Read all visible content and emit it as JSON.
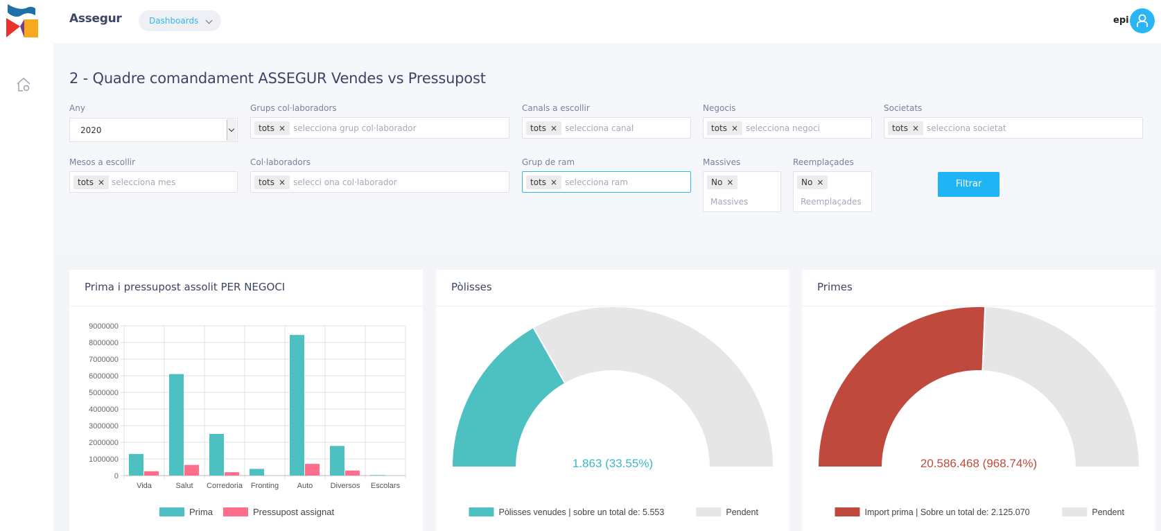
{
  "header": {
    "brand": "Assegur",
    "dashboards_label": "Dashboards",
    "user": "epi"
  },
  "page": {
    "title": "2 - Quadre comandament ASSEGUR Vendes vs Pressupost"
  },
  "filters": {
    "any": {
      "label": "Any",
      "value": "2020"
    },
    "grups": {
      "label": "Grups col·laboradors",
      "tag": "tots",
      "placeholder": "selecciona grup col·laborador"
    },
    "canals": {
      "label": "Canals a escollir",
      "tag": "tots",
      "placeholder": "selecciona canal"
    },
    "negocis": {
      "label": "Negocis",
      "tag": "tots",
      "placeholder": "selecciona negoci"
    },
    "societats": {
      "label": "Societats",
      "tag": "tots",
      "placeholder": "selecciona societat"
    },
    "mesos": {
      "label": "Mesos a escollir",
      "tag": "tots",
      "placeholder": "selecciona mes"
    },
    "collaboradors": {
      "label": "Col·laboradors",
      "tag": "tots",
      "placeholder": "selecci ona col·laborador"
    },
    "ram": {
      "label": "Grup de ram",
      "tag": "tots",
      "placeholder": "selecciona ram"
    },
    "massives": {
      "label": "Massives",
      "tag": "No",
      "placeholder": "Massives"
    },
    "reemplacades": {
      "label": "Reemplaçades",
      "tag": "No",
      "placeholder": "Reemplaçades"
    },
    "tag_remove": "×",
    "button": "Filtrar"
  },
  "colors": {
    "teal": "#4dc1c1",
    "pink": "#ff6d8d",
    "red": "#c0493d",
    "grey": "#e6e6e6",
    "accent": "#1fb5f5"
  },
  "cards": {
    "bar": {
      "title": "Prima i pressupost assolit PER NEGOCI"
    },
    "polisses": {
      "title": "Pòlisses"
    },
    "primes": {
      "title": "Primes"
    }
  },
  "chart_data": [
    {
      "type": "bar",
      "categories": [
        "Vida",
        "Salut",
        "Corredoria",
        "Fronting",
        "Auto",
        "Diversos",
        "Escolars"
      ],
      "series": [
        {
          "name": "Prima",
          "values": [
            1300000,
            6100000,
            2500000,
            400000,
            8450000,
            1780000,
            30000
          ]
        },
        {
          "name": "Pressupost assignat",
          "values": [
            260000,
            640000,
            200000,
            0,
            700000,
            300000,
            0
          ]
        }
      ],
      "ylim": [
        0,
        9000000
      ],
      "yticks": [
        0,
        1000000,
        2000000,
        3000000,
        4000000,
        5000000,
        6000000,
        7000000,
        8000000,
        9000000
      ],
      "grid": true,
      "legend": "bottom"
    },
    {
      "type": "pie",
      "style": "half-doughnut",
      "center_label": "1.863 (33.55%)",
      "slices": [
        {
          "name": "Pòlisses venudes | sobre un total de: 5.553",
          "value": 1863
        },
        {
          "name": "Pendent",
          "value": 3690
        }
      ],
      "legend": "bottom"
    },
    {
      "type": "pie",
      "style": "half-doughnut",
      "center_label": "20.586.468 (968.74%)",
      "slices": [
        {
          "name": "Import prima | Sobre un total de: 2.125.070",
          "value": 2125070
        },
        {
          "name": "Pendent",
          "value": 2020000
        }
      ],
      "legend": "bottom"
    }
  ]
}
